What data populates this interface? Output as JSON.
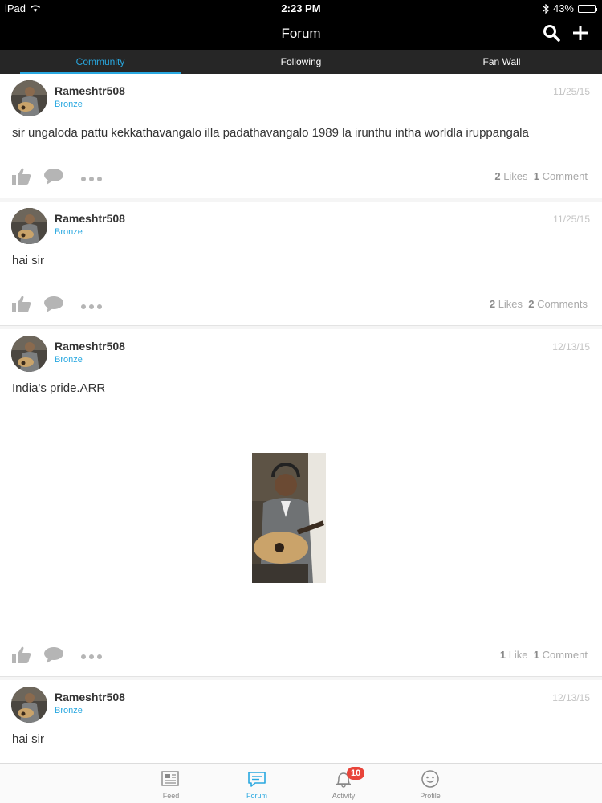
{
  "status_bar": {
    "device": "iPad",
    "time": "2:23 PM",
    "battery": "43%",
    "battery_level": 0.43
  },
  "nav": {
    "title": "Forum",
    "search_icon": "search-icon",
    "add_icon": "plus-icon"
  },
  "tabs": [
    {
      "label": "Community",
      "active": true
    },
    {
      "label": "Following",
      "active": false
    },
    {
      "label": "Fan Wall",
      "active": false
    }
  ],
  "posts": [
    {
      "username": "Rameshtr508",
      "rank": "Bronze",
      "date": "11/25/15",
      "text": "sir ungaloda pattu kekkathavangalo illa padathavangalo 1989 la irunthu intha worldla iruppangala",
      "likes_count": "2",
      "likes_label": "Likes",
      "comments_count": "1",
      "comments_label": "Comment"
    },
    {
      "username": "Rameshtr508",
      "rank": "Bronze",
      "date": "11/25/15",
      "text": "hai sir",
      "likes_count": "2",
      "likes_label": "Likes",
      "comments_count": "2",
      "comments_label": "Comments"
    },
    {
      "username": "Rameshtr508",
      "rank": "Bronze",
      "date": "12/13/15",
      "text": "India's pride.ARR",
      "likes_count": "1",
      "likes_label": "Like",
      "comments_count": "1",
      "comments_label": "Comment"
    },
    {
      "username": "Rameshtr508",
      "rank": "Bronze",
      "date": "12/13/15",
      "text": "hai sir"
    }
  ],
  "bottom_nav": [
    {
      "label": "Feed",
      "icon": "newspaper-icon",
      "active": false
    },
    {
      "label": "Forum",
      "icon": "chat-bubble-icon",
      "active": true
    },
    {
      "label": "Activity",
      "icon": "bell-icon",
      "active": false,
      "badge": "10"
    },
    {
      "label": "Profile",
      "icon": "smiley-icon",
      "active": false
    }
  ],
  "colors": {
    "accent": "#29a8e0",
    "nav_bg": "#000000",
    "tab_bg": "#262626",
    "badge": "#e8443a"
  }
}
